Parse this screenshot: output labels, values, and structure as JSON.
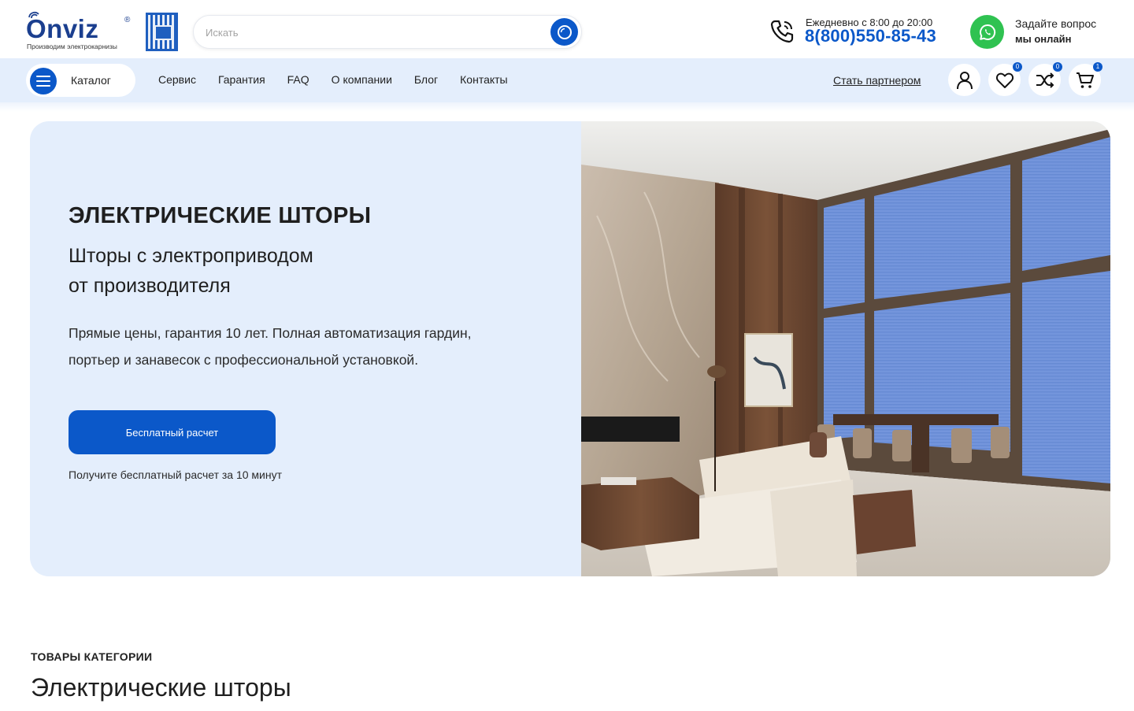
{
  "header": {
    "logo_text": "Onviz",
    "logo_reg": "®",
    "logo_tagline": "Производим электрокарнизы",
    "search_placeholder": "Искать",
    "hours": "Ежедневно с 8:00 до 20:00",
    "phone": "8(800)550-85-43",
    "ask_label": "Задайте вопрос",
    "online_label": "мы онлайн"
  },
  "nav": {
    "catalog_label": "Каталог",
    "links": [
      "Сервис",
      "Гарантия",
      "FAQ",
      "О компании",
      "Блог",
      "Контакты"
    ],
    "partner_label": "Стать партнером",
    "badges": {
      "favorites": "0",
      "compare": "0",
      "cart": "1"
    }
  },
  "hero": {
    "title": "ЭЛЕКТРИЧЕСКИЕ ШТОРЫ",
    "subtitle_line1": "Шторы с электроприводом",
    "subtitle_line2": "от производителя",
    "desc_line1": "Прямые цены, гарантия 10 лет. Полная автоматизация гардин,",
    "desc_line2": "портьер и занавесок с профессиональной установкой.",
    "cta_label": "Бесплатный расчет",
    "cta_note": "Получите бесплатный расчет за 10 минут"
  },
  "section": {
    "tag": "ТОВАРЫ КАТЕГОРИИ",
    "title": "Электрические шторы"
  },
  "colors": {
    "accent": "#0b58c9",
    "nav_bg": "#e4eefc",
    "whatsapp": "#2fc251",
    "brand": "#1b3f8f"
  }
}
